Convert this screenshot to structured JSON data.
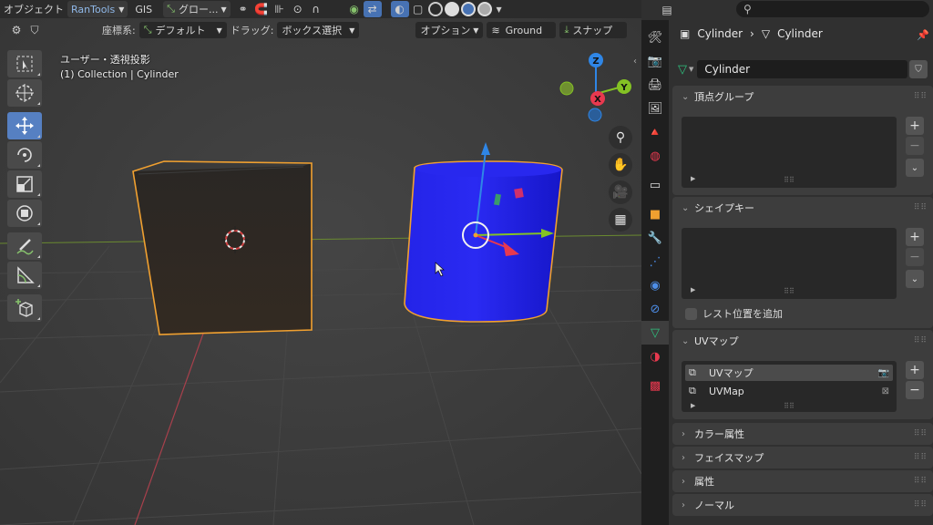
{
  "header": {
    "mode": "オブジェクト",
    "menu_rantools": "RanTools",
    "menu_gis": "GIS",
    "transform_orientation": "グロー..."
  },
  "tool_header": {
    "coord_label": "座標系:",
    "coord_value": "デフォルト",
    "drag_label": "ドラッグ:",
    "drag_value": "ボックス選択",
    "options": "オプション",
    "ground": "Ground",
    "snap": "スナップ"
  },
  "viewport": {
    "view_name": "ユーザー・透視投影",
    "collection_info": "(1) Collection | Cylinder",
    "gizmo_x": "X",
    "gizmo_y": "Y",
    "gizmo_z": "Z"
  },
  "properties": {
    "breadcrumb_object": "Cylinder",
    "breadcrumb_mesh": "Cylinder",
    "mesh_name": "Cylinder",
    "vertex_groups": "頂点グループ",
    "shape_keys": "シェイプキー",
    "add_rest_position": "レスト位置を追加",
    "uv_maps": "UVマップ",
    "uv_list": [
      "UVマップ",
      "UVMap"
    ],
    "color_attributes": "カラー属性",
    "face_maps": "フェイスマップ",
    "attributes": "属性",
    "normals": "ノーマル"
  },
  "colors": {
    "accent": "#4772b3",
    "selection_outline": "#f0a030",
    "cylinder": "#2020e0",
    "cube": "#2c2824",
    "axis_x": "#e8394f",
    "axis_y": "#84c224",
    "axis_z": "#2f86e6"
  }
}
